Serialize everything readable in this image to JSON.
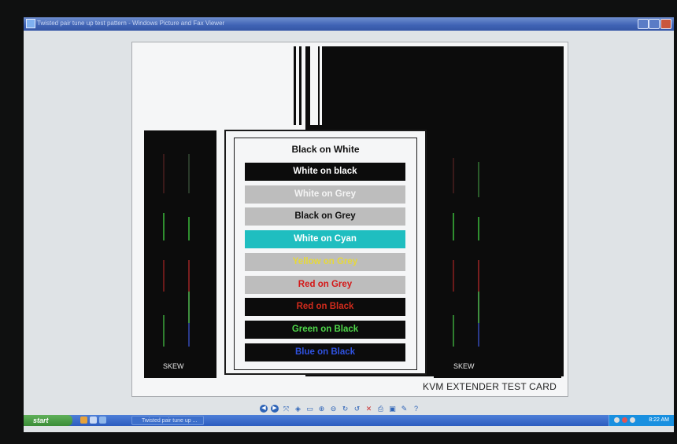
{
  "window": {
    "title": "Twisted pair tune up test pattern - Windows Picture and Fax Viewer"
  },
  "card": {
    "header": "Black on White",
    "bars": [
      {
        "label": "White on black",
        "bg": "#0c0c0c",
        "fg": "#ffffff"
      },
      {
        "label": "White on Grey",
        "bg": "#bdbdbd",
        "fg": "#f4f4f4"
      },
      {
        "label": "Black on Grey",
        "bg": "#bdbdbd",
        "fg": "#111111"
      },
      {
        "label": "White on Cyan",
        "bg": "#1fbec0",
        "fg": "#ffffff"
      },
      {
        "label": "Yellow on Grey",
        "bg": "#bdbdbd",
        "fg": "#e6d83a"
      },
      {
        "label": "Red on Grey",
        "bg": "#bdbdbd",
        "fg": "#d41818"
      },
      {
        "label": "Red on Black",
        "bg": "#0c0c0c",
        "fg": "#d22b1c"
      },
      {
        "label": "Green on Black",
        "bg": "#0c0c0c",
        "fg": "#4fd84a"
      },
      {
        "label": "Blue on Black",
        "bg": "#0c0c0c",
        "fg": "#2f52e0"
      }
    ],
    "skew_left_label": "SKEW",
    "skew_right_label": "SKEW",
    "caption": "KVM EXTENDER TEST CARD"
  },
  "toolbar": {
    "tools": [
      {
        "name": "previous-image-button",
        "glyph": "◀",
        "style": "round"
      },
      {
        "name": "next-image-button",
        "glyph": "▶",
        "style": "round"
      },
      {
        "name": "best-fit-button",
        "glyph": "⤧",
        "style": ""
      },
      {
        "name": "actual-size-button",
        "glyph": "◈",
        "style": ""
      },
      {
        "name": "slideshow-button",
        "glyph": "▭",
        "style": ""
      },
      {
        "name": "zoom-in-button",
        "glyph": "⊕",
        "style": ""
      },
      {
        "name": "zoom-out-button",
        "glyph": "⊖",
        "style": ""
      },
      {
        "name": "rotate-clockwise-button",
        "glyph": "↻",
        "style": ""
      },
      {
        "name": "rotate-counterclockwise-button",
        "glyph": "↺",
        "style": ""
      },
      {
        "name": "delete-button",
        "glyph": "✕",
        "style": "red"
      },
      {
        "name": "print-button",
        "glyph": "⎙",
        "style": ""
      },
      {
        "name": "save-button",
        "glyph": "▣",
        "style": ""
      },
      {
        "name": "edit-button",
        "glyph": "✎",
        "style": ""
      },
      {
        "name": "help-button",
        "glyph": "?",
        "style": ""
      }
    ]
  },
  "taskbar": {
    "start_label": "start",
    "task_button_label": "Twisted pair tune up ...",
    "clock": "8:22 AM"
  }
}
